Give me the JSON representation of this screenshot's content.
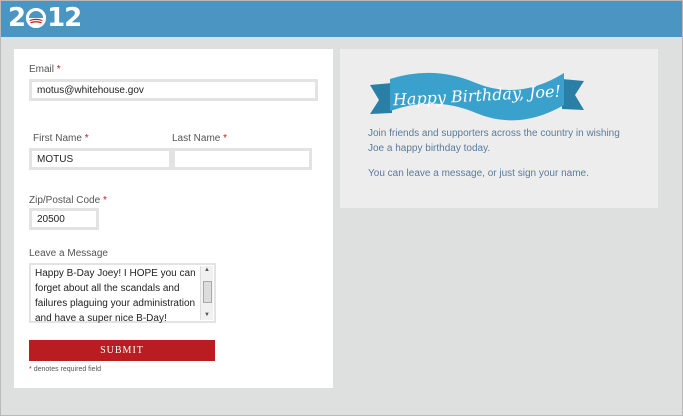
{
  "header": {
    "logo_text": "2012",
    "logo_prefix": "2",
    "logo_suffix": "12"
  },
  "form": {
    "email": {
      "label": "Email",
      "required_mark": "*",
      "value": "motus@whitehouse.gov"
    },
    "first_name": {
      "label": "First Name",
      "required_mark": "*",
      "value": "MOTUS"
    },
    "last_name": {
      "label": "Last Name",
      "required_mark": "*",
      "value": ""
    },
    "zip": {
      "label": "Zip/Postal Code",
      "required_mark": "*",
      "value": "20500"
    },
    "message": {
      "label": "Leave a Message",
      "value": "Happy B-Day Joey! I HOPE you can forget about all the scandals and failures plaguing your administration and have a super nice B-Day!"
    },
    "submit_label": "SUBMIT",
    "note": {
      "mark": "*",
      "text": "denotes required field"
    }
  },
  "info": {
    "banner_text": "Happy Birthday, Joe!",
    "paragraph1": "Join friends and supporters across the country in wishing Joe a happy birthday today.",
    "paragraph2": "You can leave a message, or just sign your name."
  },
  "colors": {
    "header_blue": "#4b95c2",
    "banner_blue": "#3aa0cc",
    "submit_red": "#b91d22",
    "required_red": "#c0181f",
    "info_text": "#5b7b9b"
  }
}
